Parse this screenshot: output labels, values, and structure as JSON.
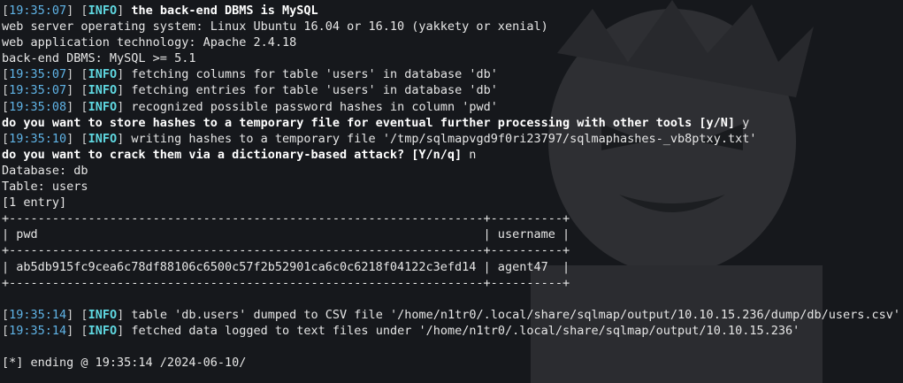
{
  "lines": [
    {
      "ts": "19:35:07",
      "level": "INFO",
      "msg": " the back-end DBMS is MySQL",
      "bold": true
    },
    {
      "text": "web server operating system: Linux Ubuntu 16.04 or 16.10 (yakkety or xenial)"
    },
    {
      "text": "web application technology: Apache 2.4.18"
    },
    {
      "text": "back-end DBMS: MySQL >= 5.1"
    },
    {
      "ts": "19:35:07",
      "level": "INFO",
      "msg": " fetching columns for table 'users' in database 'db'"
    },
    {
      "ts": "19:35:07",
      "level": "INFO",
      "msg": " fetching entries for table 'users' in database 'db'"
    },
    {
      "ts": "19:35:08",
      "level": "INFO",
      "msg": " recognized possible password hashes in column 'pwd'"
    },
    {
      "prompt": "do you want to store hashes to a temporary file for eventual further processing with other tools [y/N]",
      "answer": " y"
    },
    {
      "ts": "19:35:10",
      "level": "INFO",
      "msg": " writing hashes to a temporary file '/tmp/sqlmapvgd9f0ri23797/sqlmaphashes-_vb8ptxy.txt'"
    },
    {
      "prompt": "do you want to crack them via a dictionary-based attack? [Y/n/q]",
      "answer": " n"
    },
    {
      "text": "Database: db"
    },
    {
      "text": "Table: users"
    },
    {
      "text": "[1 entry]"
    },
    {
      "text": "+------------------------------------------------------------------+----------+"
    },
    {
      "text": "| pwd                                                              | username |"
    },
    {
      "text": "+------------------------------------------------------------------+----------+"
    },
    {
      "text": "| ab5db915fc9cea6c78df88106c6500c57f2b52901ca6c0c6218f04122c3efd14 | agent47  |"
    },
    {
      "text": "+------------------------------------------------------------------+----------+"
    },
    {
      "text": ""
    },
    {
      "ts": "19:35:14",
      "level": "INFO",
      "msg": " table 'db.users' dumped to CSV file '/home/n1tr0/.local/share/sqlmap/output/10.10.15.236/dump/db/users.csv'"
    },
    {
      "ts": "19:35:14",
      "level": "INFO",
      "msg": " fetched data logged to text files under '/home/n1tr0/.local/share/sqlmap/output/10.10.15.236'"
    },
    {
      "text": ""
    },
    {
      "text": "[*] ending @ 19:35:14 /2024-06-10/"
    }
  ],
  "colors": {
    "background": "#16181c",
    "timestamp": "#5fb3e6",
    "info": "#5fd7e0",
    "text": "#e6e6e6"
  }
}
